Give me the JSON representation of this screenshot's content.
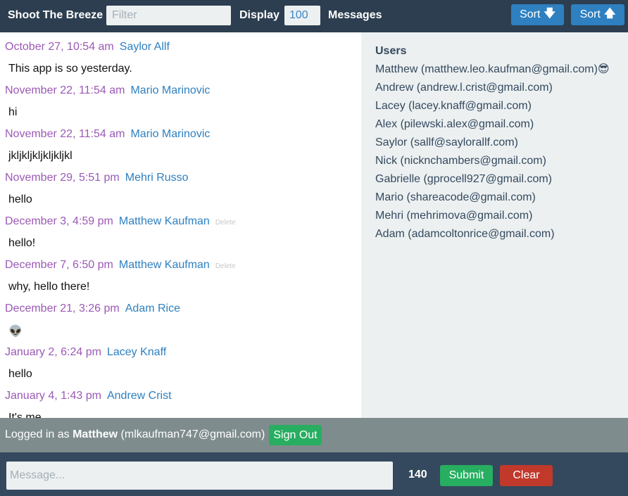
{
  "header": {
    "title": "Shoot The Breeze",
    "filter_placeholder": "Filter",
    "display_label": "Display",
    "display_count": "100",
    "messages_label": "Messages",
    "sort_down_label": "Sort",
    "sort_down_icon": "arrow-down-icon",
    "sort_up_label": "Sort",
    "sort_up_icon": "arrow-up-icon"
  },
  "messages": [
    {
      "date": "October 27, 10:54 am",
      "author": "Saylor Allf",
      "delete": "",
      "text": "This app is so yesterday."
    },
    {
      "date": "November 22, 11:54 am",
      "author": "Mario Marinovic",
      "delete": "",
      "text": "hi"
    },
    {
      "date": "November 22, 11:54 am",
      "author": "Mario Marinovic",
      "delete": "",
      "text": "jkljkljkljkljkljkl"
    },
    {
      "date": "November 29, 5:51 pm",
      "author": "Mehri Russo",
      "delete": "",
      "text": "hello"
    },
    {
      "date": "December 3, 4:59 pm",
      "author": "Matthew Kaufman",
      "delete": "Delete",
      "text": "hello!"
    },
    {
      "date": "December 7, 6:50 pm",
      "author": "Matthew Kaufman",
      "delete": "Delete",
      "text": "why, hello there!"
    },
    {
      "date": "December 21, 3:26 pm",
      "author": "Adam Rice",
      "delete": "",
      "text": "👽"
    },
    {
      "date": "January 2, 6:24 pm",
      "author": "Lacey Knaff",
      "delete": "",
      "text": "hello"
    },
    {
      "date": "January 4, 1:43 pm",
      "author": "Andrew Crist",
      "delete": "",
      "text": "It's me"
    }
  ],
  "users": {
    "title": "Users",
    "list": [
      "Matthew (matthew.leo.kaufman@gmail.com)😎",
      "Andrew (andrew.l.crist@gmail.com)",
      "Lacey (lacey.knaff@gmail.com)",
      "Alex (pilewski.alex@gmail.com)",
      "Saylor (sallf@saylorallf.com)",
      "Nick (nicknchambers@gmail.com)",
      "Gabrielle (gprocell927@gmail.com)",
      "Mario (shareacode@gmail.com)",
      "Mehri (mehrimova@gmail.com)",
      "Adam (adamcoltonrice@gmail.com)"
    ]
  },
  "status": {
    "prefix": "Logged in as",
    "user_name": "Matthew",
    "user_email": "(mlkaufman747@gmail.com)",
    "signout_label": "Sign Out"
  },
  "composer": {
    "placeholder": "Message...",
    "chars_remaining": "140",
    "submit_label": "Submit",
    "clear_label": "Clear"
  },
  "colors": {
    "header_bg": "#2c3e50",
    "date": "#9b59b6",
    "author": "#2e80c0",
    "sidebar_bg": "#ecf0f1",
    "status_bg": "#7f8c8d",
    "success": "#27ae60",
    "danger": "#c0392b"
  }
}
